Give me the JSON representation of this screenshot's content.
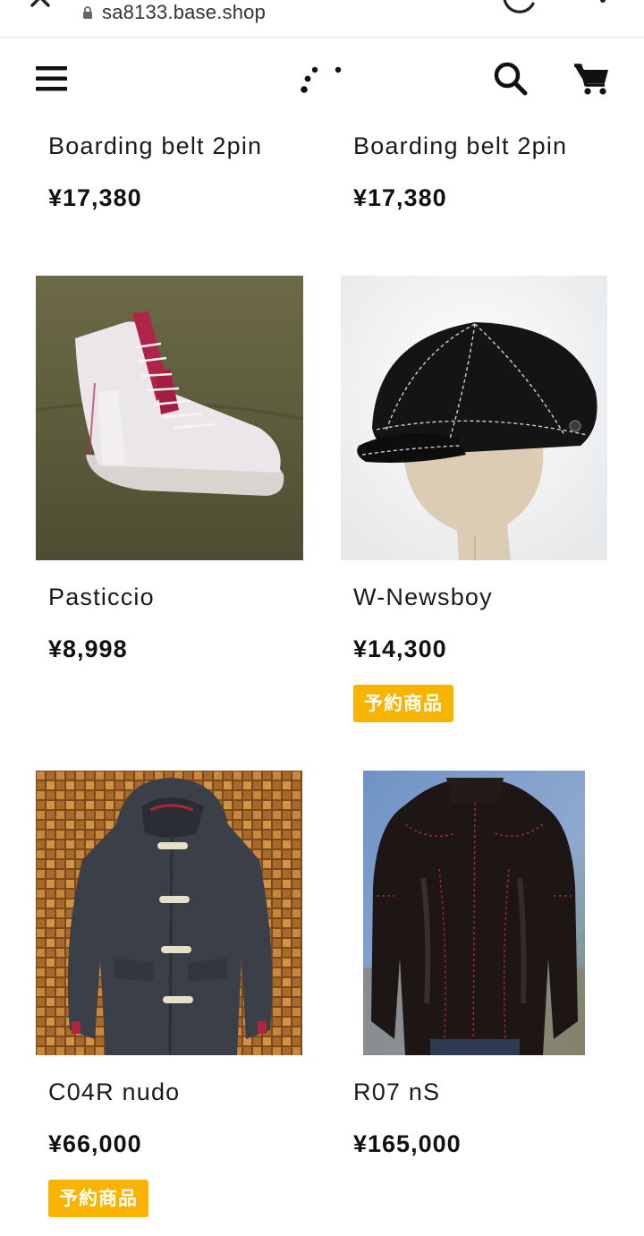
{
  "browser": {
    "url": "sa8133.base.shop"
  },
  "header": {
    "icons": [
      "menu-icon",
      "logo-mark",
      "search-icon",
      "cart-icon"
    ]
  },
  "products": [
    {
      "name": "Boarding belt 2pin",
      "price": "¥17,380",
      "badge": null
    },
    {
      "name": "Boarding belt 2pin",
      "price": "¥17,380",
      "badge": null
    },
    {
      "name": "Pasticcio",
      "price": "¥8,998",
      "badge": null
    },
    {
      "name": "W-Newsboy",
      "price": "¥14,300",
      "badge": "予約商品"
    },
    {
      "name": "C04R nudo",
      "price": "¥66,000",
      "badge": "予約商品"
    },
    {
      "name": "R07 nS",
      "price": "¥165,000",
      "badge": null
    }
  ],
  "colors": {
    "badge": "#f8b400",
    "text": "#111111",
    "url_text": "#333333"
  }
}
